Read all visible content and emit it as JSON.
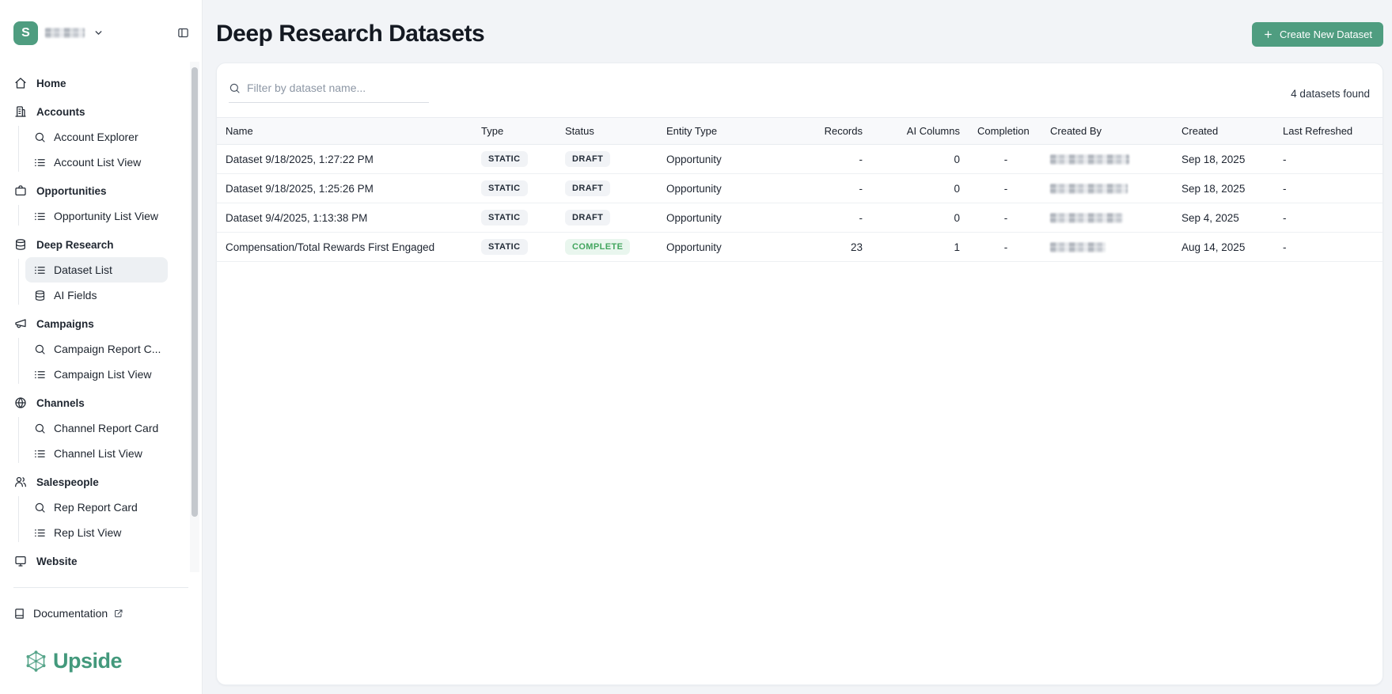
{
  "sidebar": {
    "workspace": {
      "initial": "S",
      "name_redacted": true
    },
    "nav": [
      {
        "label": "Home",
        "icon": "home"
      },
      {
        "label": "Accounts",
        "icon": "building",
        "children": [
          {
            "label": "Account Explorer",
            "icon": "search"
          },
          {
            "label": "Account List View",
            "icon": "list"
          }
        ]
      },
      {
        "label": "Opportunities",
        "icon": "briefcase",
        "children": [
          {
            "label": "Opportunity List View",
            "icon": "list"
          }
        ]
      },
      {
        "label": "Deep Research",
        "icon": "database",
        "children": [
          {
            "label": "Dataset List",
            "icon": "list",
            "selected": true
          },
          {
            "label": "AI Fields",
            "icon": "database"
          }
        ]
      },
      {
        "label": "Campaigns",
        "icon": "megaphone",
        "children": [
          {
            "label": "Campaign Report C...",
            "icon": "search"
          },
          {
            "label": "Campaign List View",
            "icon": "list"
          }
        ]
      },
      {
        "label": "Channels",
        "icon": "globe",
        "children": [
          {
            "label": "Channel Report Card",
            "icon": "search"
          },
          {
            "label": "Channel List View",
            "icon": "list"
          }
        ]
      },
      {
        "label": "Salespeople",
        "icon": "users",
        "children": [
          {
            "label": "Rep Report Card",
            "icon": "search"
          },
          {
            "label": "Rep List View",
            "icon": "list"
          }
        ]
      },
      {
        "label": "Website",
        "icon": "monitor"
      }
    ],
    "footer": {
      "documentation_label": "Documentation",
      "brand": "Upside"
    }
  },
  "header": {
    "title": "Deep Research Datasets",
    "create_button_label": "Create New Dataset"
  },
  "toolbar": {
    "filter_placeholder": "Filter by dataset name...",
    "results_count": "4 datasets found"
  },
  "table": {
    "columns": [
      "Name",
      "Type",
      "Status",
      "Entity Type",
      "Records",
      "AI Columns",
      "Completion",
      "Created By",
      "Created",
      "Last Refreshed"
    ],
    "rows": [
      {
        "name": "Dataset 9/18/2025, 1:27:22 PM",
        "type": "STATIC",
        "status": "DRAFT",
        "entity_type": "Opportunity",
        "records": "-",
        "ai_columns": "0",
        "completion": "-",
        "created_by": "",
        "created": "Sep 18, 2025",
        "last_refreshed": "-"
      },
      {
        "name": "Dataset 9/18/2025, 1:25:26 PM",
        "type": "STATIC",
        "status": "DRAFT",
        "entity_type": "Opportunity",
        "records": "-",
        "ai_columns": "0",
        "completion": "-",
        "created_by": "",
        "created": "Sep 18, 2025",
        "last_refreshed": "-"
      },
      {
        "name": "Dataset 9/4/2025, 1:13:38 PM",
        "type": "STATIC",
        "status": "DRAFT",
        "entity_type": "Opportunity",
        "records": "-",
        "ai_columns": "0",
        "completion": "-",
        "created_by": "",
        "created": "Sep 4, 2025",
        "last_refreshed": "-"
      },
      {
        "name": "Compensation/Total Rewards First Engaged",
        "type": "STATIC",
        "status": "COMPLETE",
        "entity_type": "Opportunity",
        "records": "23",
        "ai_columns": "1",
        "completion": "-",
        "created_by": "",
        "created": "Aug 14, 2025",
        "last_refreshed": "-"
      }
    ]
  },
  "colors": {
    "accent_green": "#4f9d80",
    "badge_bg": "#f1f3f6",
    "badge_complete_bg": "#e9f6ee",
    "badge_complete_text": "#43a65f"
  }
}
